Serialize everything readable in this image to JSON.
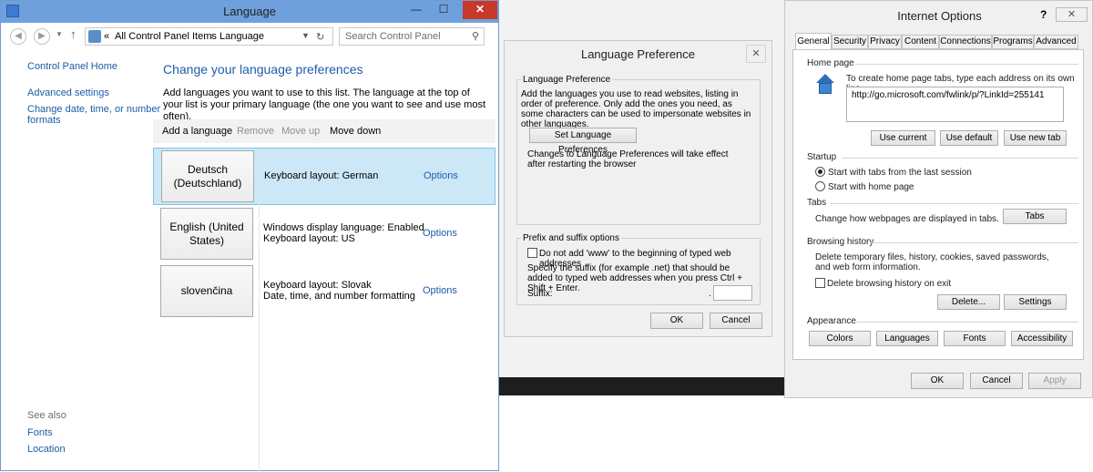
{
  "language_window": {
    "title": "Language",
    "minimize": "—",
    "maximize": "☐",
    "close": "✕",
    "breadcrumb": {
      "root_sep": "«",
      "items": [
        "All Control Panel Items",
        "Language"
      ]
    },
    "search_placeholder": "Search Control Panel",
    "left_nav": {
      "home": "Control Panel Home",
      "advanced": "Advanced settings",
      "change_date_1": "Change date, time, or number",
      "change_date_2": "formats",
      "see_also": "See also",
      "fonts": "Fonts",
      "location": "Location"
    },
    "heading": "Change your language preferences",
    "description": "Add languages you want to use to this list. The language at the top of your list is your primary language (the one you want to see and use most often).",
    "toolbar": {
      "add": "Add a language",
      "remove": "Remove",
      "move_up": "Move up",
      "move_down": "Move down"
    },
    "languages": [
      {
        "name": "Deutsch (Deutschland)",
        "desc1": "Keyboard layout: German",
        "desc2": "",
        "options": "Options"
      },
      {
        "name": "English (United States)",
        "desc1": "Windows display language: Enabled",
        "desc2": "Keyboard layout: US",
        "options": "Options"
      },
      {
        "name": "slovenčina",
        "desc1": "Keyboard layout: Slovak",
        "desc2": "Date, time, and number formatting",
        "options": "Options"
      }
    ]
  },
  "language_preference": {
    "title": "Language Preference",
    "group1_legend": "Language Preference",
    "group1_text": "Add the languages you use to read websites, listing in order of preference. Only add the ones you need, as some characters can be used to impersonate websites in other languages.",
    "set_button": "Set Language Preferences",
    "note": "Changes to Language Preferences will take effect after restarting the browser",
    "group2_legend": "Prefix and suffix options",
    "checkbox_label": "Do not add 'www' to the beginning of typed web addresses",
    "suffix_text": "Specify the suffix (for example .net) that should be added to typed web addresses when you press Ctrl + Shift + Enter.",
    "suffix_label": "Suffix:",
    "suffix_dot": ".",
    "ok": "OK",
    "cancel": "Cancel"
  },
  "internet_options": {
    "title": "Internet Options",
    "help": "?",
    "tabs": [
      "General",
      "Security",
      "Privacy",
      "Content",
      "Connections",
      "Programs",
      "Advanced"
    ],
    "home_page": {
      "label": "Home page",
      "instruction": "To create home page tabs, type each address on its own line.",
      "url": "http://go.microsoft.com/fwlink/p/?LinkId=255141",
      "use_current": "Use current",
      "use_default": "Use default",
      "use_new_tab": "Use new tab"
    },
    "startup": {
      "label": "Startup",
      "option1": "Start with tabs from the last session",
      "option2": "Start with home page"
    },
    "tabs_section": {
      "label": "Tabs",
      "text": "Change how webpages are displayed in tabs.",
      "button": "Tabs"
    },
    "browsing_history": {
      "label": "Browsing history",
      "text": "Delete temporary files, history, cookies, saved passwords, and web form information.",
      "checkbox": "Delete browsing history on exit",
      "delete": "Delete...",
      "settings": "Settings"
    },
    "appearance": {
      "label": "Appearance",
      "colors": "Colors",
      "languages": "Languages",
      "fonts": "Fonts",
      "accessibility": "Accessibility"
    },
    "ok": "OK",
    "cancel": "Cancel",
    "apply": "Apply"
  }
}
